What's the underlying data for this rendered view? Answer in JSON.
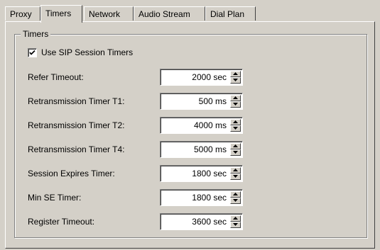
{
  "tabs": [
    {
      "label": "Proxy",
      "active": false
    },
    {
      "label": "Timers",
      "active": true
    },
    {
      "label": "Network",
      "active": false
    },
    {
      "label": "Audio Stream",
      "active": false
    },
    {
      "label": "Dial Plan",
      "active": false
    }
  ],
  "group": {
    "title": "Timers",
    "use_session_timers": {
      "label": "Use SIP Session Timers",
      "checked": true
    },
    "fields": [
      {
        "label": "Refer Timeout:",
        "value": "2000 sec"
      },
      {
        "label": "Retransmission Timer T1:",
        "value": "500 ms"
      },
      {
        "label": "Retransmission Timer T2:",
        "value": "4000 ms"
      },
      {
        "label": "Retransmission Timer T4:",
        "value": "5000 ms"
      },
      {
        "label": "Session Expires Timer:",
        "value": "1800 sec"
      },
      {
        "label": "Min SE Timer:",
        "value": "1800 sec"
      },
      {
        "label": "Register Timeout:",
        "value": "3600 sec"
      }
    ]
  },
  "colors": {
    "face": "#d4d0c8",
    "field": "#ffffff",
    "shadow": "#808080"
  },
  "icons": {
    "spin_up": "arrow-up-icon",
    "spin_down": "arrow-down-icon",
    "check": "checkmark-icon"
  }
}
